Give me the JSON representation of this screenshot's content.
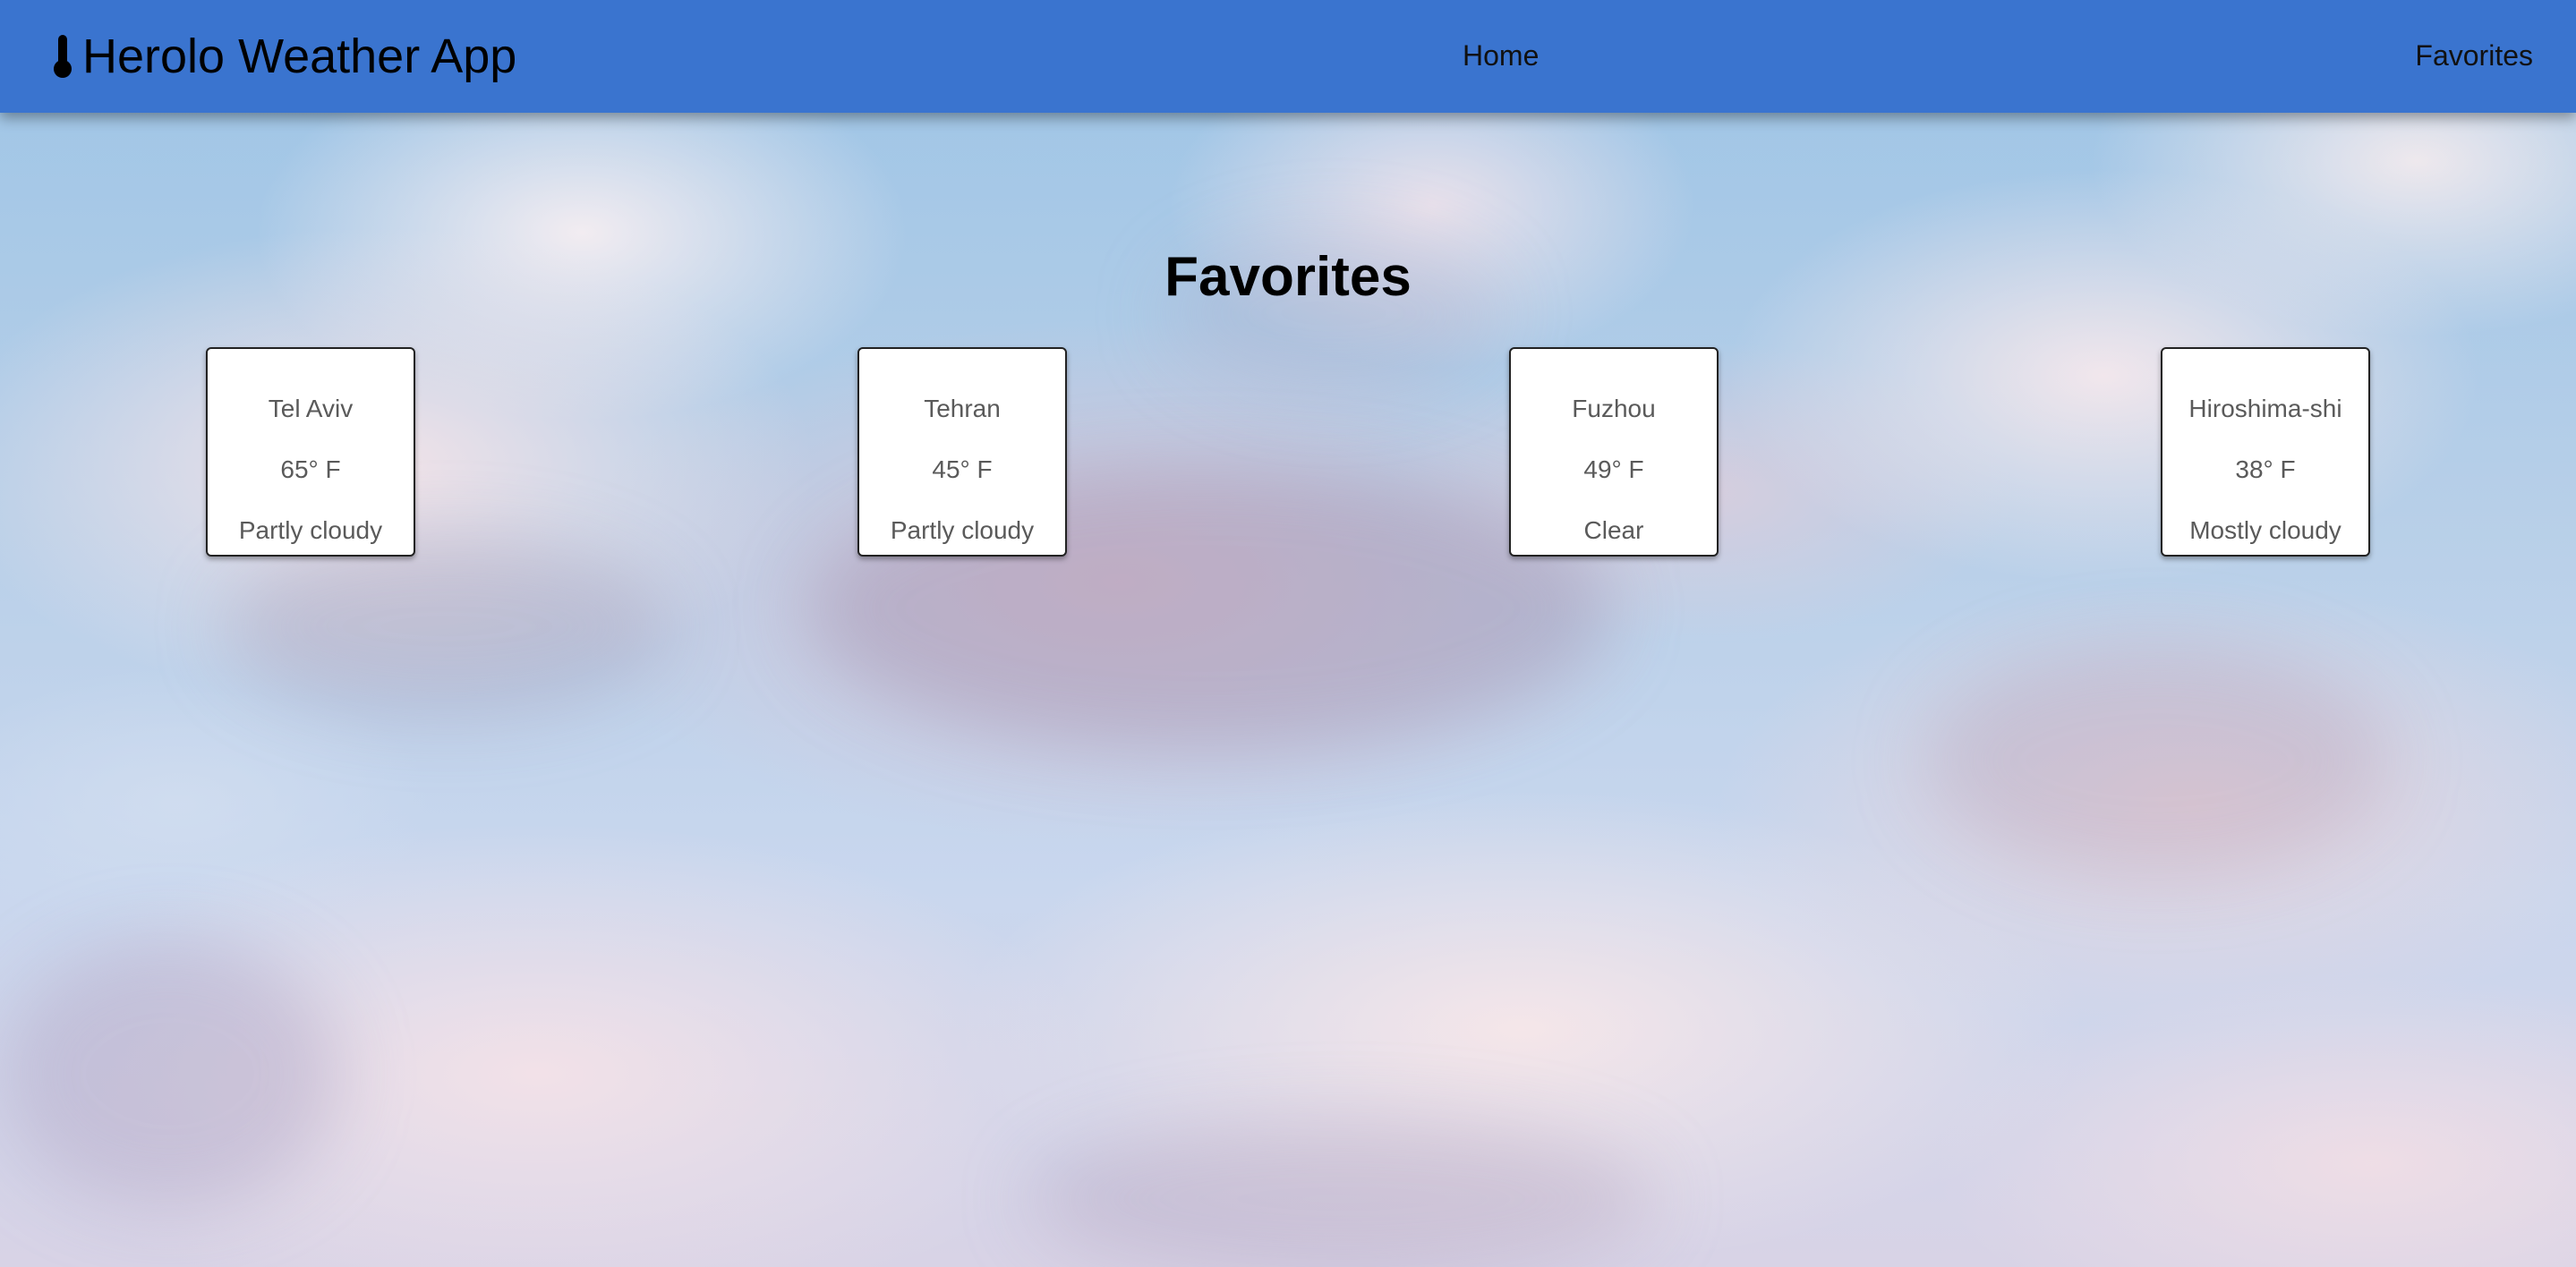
{
  "app": {
    "title": "Herolo Weather App",
    "icon": "thermometer-icon"
  },
  "nav": {
    "home_label": "Home",
    "favorites_label": "Favorites"
  },
  "page": {
    "title": "Favorites"
  },
  "favorites": [
    {
      "city": "Tel Aviv",
      "temperature": "65° F",
      "condition": "Partly cloudy"
    },
    {
      "city": "Tehran",
      "temperature": "45° F",
      "condition": "Partly cloudy"
    },
    {
      "city": "Fuzhou",
      "temperature": "49° F",
      "condition": "Clear"
    },
    {
      "city": "Hiroshima-shi",
      "temperature": "38° F",
      "condition": "Mostly cloudy"
    }
  ],
  "colors": {
    "header_bg": "#3a74cf",
    "card_bg": "#ffffff",
    "card_text": "#5a5a5a"
  }
}
